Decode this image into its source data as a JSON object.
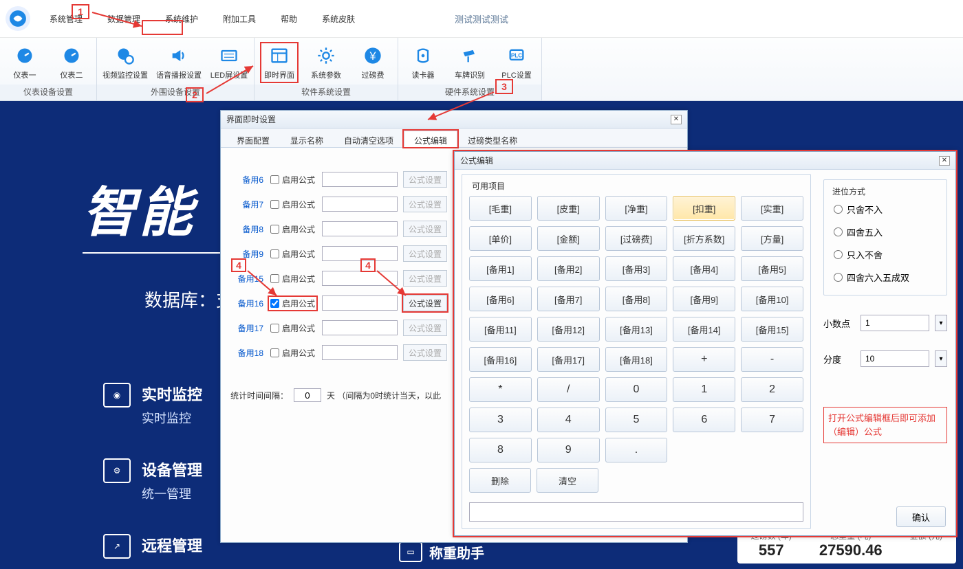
{
  "app_title": "测试测试测试",
  "menu": [
    "系统管理",
    "数据管理",
    "系统维护",
    "附加工具",
    "帮助",
    "系统皮肤"
  ],
  "ribbon": {
    "groups": [
      {
        "label": "仪表设备设置",
        "tools": [
          {
            "name": "仪表一",
            "icon": "gauge"
          },
          {
            "name": "仪表二",
            "icon": "gauge"
          }
        ]
      },
      {
        "label": "外围设备设置",
        "tools": [
          {
            "name": "视频监控设置",
            "icon": "camera-gear"
          },
          {
            "name": "语音播报设置",
            "icon": "speaker"
          },
          {
            "name": "LED屏设置",
            "icon": "led"
          }
        ]
      },
      {
        "label": "软件系统设置",
        "tools": [
          {
            "name": "即时界面",
            "icon": "window",
            "highlight": true
          },
          {
            "name": "系统参数",
            "icon": "gear"
          },
          {
            "name": "过磅费",
            "icon": "yen"
          }
        ]
      },
      {
        "label": "硬件系统设置",
        "tools": [
          {
            "name": "读卡器",
            "icon": "card"
          },
          {
            "name": "车牌识别",
            "icon": "camera"
          },
          {
            "name": "PLC设置",
            "icon": "plc"
          }
        ]
      }
    ]
  },
  "dlg1": {
    "title": "界面即时设置",
    "tabs": [
      "界面配置",
      "显示名称",
      "自动清空选项",
      "公式编辑",
      "过磅类型名称"
    ],
    "active_tab": 3,
    "rows": [
      {
        "label": "备用6",
        "check_label": "启用公式",
        "checked": false,
        "btn": "公式设置",
        "enabled": false
      },
      {
        "label": "备用7",
        "check_label": "启用公式",
        "checked": false,
        "btn": "公式设置",
        "enabled": false
      },
      {
        "label": "备用8",
        "check_label": "启用公式",
        "checked": false,
        "btn": "公式设置",
        "enabled": false
      },
      {
        "label": "备用9",
        "check_label": "启用公式",
        "checked": false,
        "btn": "公式设置",
        "enabled": false
      },
      {
        "label": "备用15",
        "check_label": "启用公式",
        "checked": false,
        "btn": "公式设置",
        "enabled": false
      },
      {
        "label": "备用16",
        "check_label": "启用公式",
        "checked": true,
        "btn": "公式设置",
        "enabled": true,
        "highlight": true
      },
      {
        "label": "备用17",
        "check_label": "启用公式",
        "checked": false,
        "btn": "公式设置",
        "enabled": false
      },
      {
        "label": "备用18",
        "check_label": "启用公式",
        "checked": false,
        "btn": "公式设置",
        "enabled": false
      }
    ],
    "stat_label": "统计时间间隔：",
    "stat_val": "0",
    "stat_suffix": "天 （间隔为0时统计当天，以此"
  },
  "dlg2": {
    "title": "公式编辑",
    "available_label": "可用项目",
    "items": [
      "[毛重]",
      "[皮重]",
      "[净重]",
      "[扣重]",
      "[实重]",
      "[单价]",
      "[金额]",
      "[过磅费]",
      "[折方系数]",
      "[方量]",
      "[备用1]",
      "[备用2]",
      "[备用3]",
      "[备用4]",
      "[备用5]",
      "[备用6]",
      "[备用7]",
      "[备用8]",
      "[备用9]",
      "[备用10]",
      "[备用11]",
      "[备用12]",
      "[备用13]",
      "[备用14]",
      "[备用15]",
      "[备用16]",
      "[备用17]",
      "[备用18]"
    ],
    "active_item": 3,
    "ops": [
      "+",
      "-",
      "*",
      "/",
      "0",
      "1",
      "2",
      "3",
      "4",
      "5",
      "6",
      "7",
      "8",
      "9",
      "."
    ],
    "del_label": "删除",
    "clear_label": "清空",
    "carry_label": "进位方式",
    "carry_options": [
      "只舍不入",
      "四舍五入",
      "只入不舍",
      "四舍六入五成双"
    ],
    "decimal_label": "小数点",
    "decimal_val": "1",
    "division_label": "分度",
    "division_val": "10",
    "hint": "打开公式编辑框后即可添加（编辑）公式",
    "ok": "确认"
  },
  "bg": {
    "title": "智能",
    "db": "数据库：支",
    "items": [
      {
        "h": "实时监控",
        "p": "实时监控"
      },
      {
        "h": "设备管理",
        "p": "统一管理"
      },
      {
        "h": "远程管理",
        "p": ""
      }
    ],
    "sec": "称重助手",
    "stats": [
      {
        "lbl": "过磅数 (车)",
        "val": "557"
      },
      {
        "lbl": "总重量 (吨)",
        "val": "27590.46"
      },
      {
        "lbl": "金额 (元)",
        "val": ""
      }
    ]
  },
  "anno": {
    "1": "1",
    "2": "2",
    "3": "3",
    "4a": "4",
    "4b": "4"
  }
}
